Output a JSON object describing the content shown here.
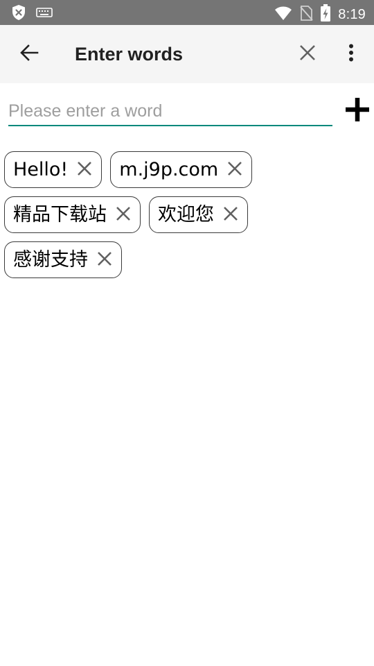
{
  "status_bar": {
    "time": "8:19",
    "icons": [
      "security-shield-icon",
      "keyboard-icon",
      "wifi-icon",
      "no-sim-icon",
      "battery-charging-icon"
    ]
  },
  "app_bar": {
    "title": "Enter words",
    "icons": [
      "back-arrow-icon",
      "close-icon",
      "more-vert-icon"
    ]
  },
  "input": {
    "value": "",
    "placeholder": "Please enter a word",
    "underline_color": "#00897b",
    "add_icon": "plus-icon"
  },
  "chips": [
    {
      "label": "Hello!",
      "remove_icon": "close-icon"
    },
    {
      "label": "m.j9p.com",
      "remove_icon": "close-icon"
    },
    {
      "label": "精品下载站",
      "remove_icon": "close-icon"
    },
    {
      "label": "欢迎您",
      "remove_icon": "close-icon"
    },
    {
      "label": "感谢支持",
      "remove_icon": "close-icon"
    }
  ],
  "colors": {
    "status_bar": "#757575",
    "app_bar": "#f5f5f5",
    "accent": "#00897b"
  }
}
